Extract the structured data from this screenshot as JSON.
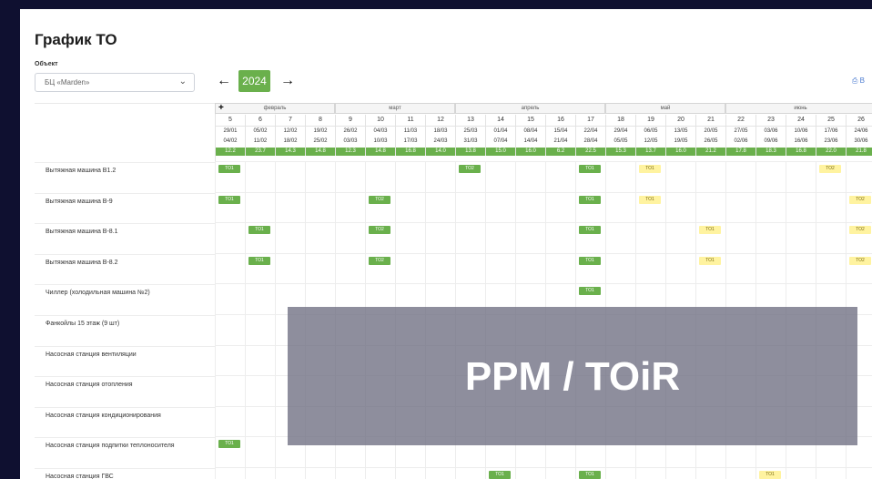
{
  "page": {
    "title": "График ТО"
  },
  "object": {
    "label": "Объект",
    "selected": "БЦ «Marden»"
  },
  "year": {
    "value": "2024"
  },
  "print_label": "В",
  "months": [
    {
      "label": "февраль",
      "start": 0,
      "span": 4
    },
    {
      "label": "март",
      "start": 4,
      "span": 4
    },
    {
      "label": "апрель",
      "start": 8,
      "span": 5
    },
    {
      "label": "май",
      "start": 13,
      "span": 4
    },
    {
      "label": "июнь",
      "start": 17,
      "span": 5
    }
  ],
  "weeks": [
    {
      "n": "5",
      "from": "29/01",
      "to": "04/02",
      "h": "12.2"
    },
    {
      "n": "6",
      "from": "05/02",
      "to": "11/02",
      "h": "23.7"
    },
    {
      "n": "7",
      "from": "12/02",
      "to": "18/02",
      "h": "14.3"
    },
    {
      "n": "8",
      "from": "19/02",
      "to": "25/02",
      "h": "14.8"
    },
    {
      "n": "9",
      "from": "26/02",
      "to": "03/03",
      "h": "12.3"
    },
    {
      "n": "10",
      "from": "04/03",
      "to": "10/03",
      "h": "14.8"
    },
    {
      "n": "11",
      "from": "11/03",
      "to": "17/03",
      "h": "16.8"
    },
    {
      "n": "12",
      "from": "18/03",
      "to": "24/03",
      "h": "14.0"
    },
    {
      "n": "13",
      "from": "25/03",
      "to": "31/03",
      "h": "13.8"
    },
    {
      "n": "14",
      "from": "01/04",
      "to": "07/04",
      "h": "15.0"
    },
    {
      "n": "15",
      "from": "08/04",
      "to": "14/04",
      "h": "16.0"
    },
    {
      "n": "16",
      "from": "15/04",
      "to": "21/04",
      "h": "6.2"
    },
    {
      "n": "17",
      "from": "22/04",
      "to": "28/04",
      "h": "22.5"
    },
    {
      "n": "18",
      "from": "29/04",
      "to": "05/05",
      "h": "15.3"
    },
    {
      "n": "19",
      "from": "06/05",
      "to": "12/05",
      "h": "13.7"
    },
    {
      "n": "20",
      "from": "13/05",
      "to": "19/05",
      "h": "16.0"
    },
    {
      "n": "21",
      "from": "20/05",
      "to": "26/05",
      "h": "21.2"
    },
    {
      "n": "22",
      "from": "27/05",
      "to": "02/06",
      "h": "17.8"
    },
    {
      "n": "23",
      "from": "03/06",
      "to": "09/06",
      "h": "18.3"
    },
    {
      "n": "24",
      "from": "10/06",
      "to": "16/06",
      "h": "16.8"
    },
    {
      "n": "25",
      "from": "17/06",
      "to": "23/06",
      "h": "22.0"
    },
    {
      "n": "26",
      "from": "24/06",
      "to": "30/06",
      "h": "21.8"
    }
  ],
  "rows": [
    {
      "label": "Вытяжная машина В1.2",
      "tasks": [
        {
          "w": 0,
          "t": "ТО1",
          "c": "green"
        },
        {
          "w": 8,
          "t": "ТО2",
          "c": "green"
        },
        {
          "w": 12,
          "t": "ТО1",
          "c": "green"
        },
        {
          "w": 14,
          "t": "ТО1",
          "c": "yellow"
        },
        {
          "w": 20,
          "t": "ТО2",
          "c": "yellow"
        }
      ]
    },
    {
      "label": "Вытяжная машина В-9",
      "tasks": [
        {
          "w": 0,
          "t": "ТО1",
          "c": "green"
        },
        {
          "w": 5,
          "t": "ТО2",
          "c": "green"
        },
        {
          "w": 12,
          "t": "ТО1",
          "c": "green"
        },
        {
          "w": 14,
          "t": "ТО1",
          "c": "yellow"
        },
        {
          "w": 21,
          "t": "ТО2",
          "c": "yellow"
        }
      ]
    },
    {
      "label": "Вытяжная машина В-8.1",
      "tasks": [
        {
          "w": 1,
          "t": "ТО1",
          "c": "green"
        },
        {
          "w": 5,
          "t": "ТО2",
          "c": "green"
        },
        {
          "w": 12,
          "t": "ТО1",
          "c": "green"
        },
        {
          "w": 16,
          "t": "ТО1",
          "c": "yellow"
        },
        {
          "w": 21,
          "t": "ТО2",
          "c": "yellow"
        }
      ]
    },
    {
      "label": "Вытяжная машина В-8.2",
      "tasks": [
        {
          "w": 1,
          "t": "ТО1",
          "c": "green"
        },
        {
          "w": 5,
          "t": "ТО2",
          "c": "green"
        },
        {
          "w": 12,
          "t": "ТО1",
          "c": "green"
        },
        {
          "w": 16,
          "t": "ТО1",
          "c": "yellow"
        },
        {
          "w": 21,
          "t": "ТО2",
          "c": "yellow"
        }
      ]
    },
    {
      "label": "Чиллер (холодильная машина №2)",
      "tasks": [
        {
          "w": 12,
          "t": "ТО1",
          "c": "green"
        }
      ]
    },
    {
      "label": "Фанкойлы 15 этаж (9 шт)",
      "tasks": []
    },
    {
      "label": "Насосная станция вентиляции",
      "tasks": []
    },
    {
      "label": "Насосная станция отопления",
      "tasks": []
    },
    {
      "label": "Насосная станция кондиционирования",
      "tasks": []
    },
    {
      "label": "Насосная станция подпитки теплоносителя",
      "tasks": [
        {
          "w": 0,
          "t": "ТО1",
          "c": "green"
        }
      ]
    },
    {
      "label": "Насосная станция ГВС",
      "tasks": [
        {
          "w": 9,
          "t": "ТО1",
          "c": "green"
        },
        {
          "w": 12,
          "t": "ТО1",
          "c": "green"
        },
        {
          "w": 18,
          "t": "ТО1",
          "c": "yellow"
        }
      ]
    }
  ],
  "banner": {
    "text": "PPM / TOiR"
  }
}
